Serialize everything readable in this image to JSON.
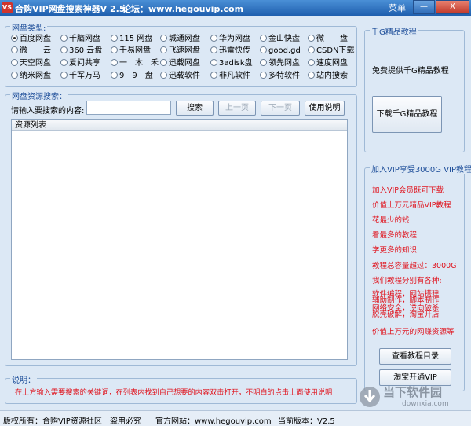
{
  "app": {
    "logo": "VS",
    "title": "合购VIP网盘搜索神器V 2.5",
    "forum": "论坛：www.hegouvip.com",
    "menu": "菜单",
    "min_glyph": "—",
    "close_glyph": "X"
  },
  "disk_type": {
    "legend": "网盘类型:",
    "options": [
      [
        "百度网盘",
        "千脑网盘",
        "115 网盘",
        "城通网盘",
        "华为网盘",
        "金山快盘",
        "微　　盘"
      ],
      [
        "微　　云",
        "360 云盘",
        "千易网盘",
        "飞速网盘",
        "迅雷快传",
        "good.gd",
        "CSDN下载"
      ],
      [
        "天空网盘",
        "爱问共享",
        "一　木　禾",
        "迅载网盘",
        "3adisk盘",
        "领先网盘",
        "速度网盘"
      ],
      [
        "纳米网盘",
        "千军万马",
        "9　9　盘",
        "迅载软件",
        "非凡软件",
        "多特软件",
        "站内搜索"
      ]
    ]
  },
  "search": {
    "legend": "网盘资源搜索：",
    "label": "请输入要搜索的内容:",
    "value": "",
    "search_btn": "搜索",
    "prev_btn": "上一页",
    "next_btn": "下一页",
    "help_btn": "使用说明",
    "list_header": "资源列表"
  },
  "note": {
    "legend": "说明：",
    "text": "在上方输入需要搜索的关键词，在列表内找到自己想要的内容双击打开，不明白的点击上面使用说明"
  },
  "tutorial": {
    "legend": "千G精品教程",
    "free_text": "免费提供千G精品教程",
    "download_btn": "下载千G精品教程"
  },
  "vip": {
    "legend": "加入VIP享受3000G VIP教程",
    "lines": [
      "加入VIP会员既可下载",
      "价值上万元精品VIP教程",
      "花最少的钱",
      "看最多的教程",
      "学更多的知识",
      "教程总容量超过：3000G",
      "我们教程分别有各种:"
    ],
    "overlap_a": "软件编程，网站搭建",
    "overlap_b": "辅助制作，脚本制作",
    "overlap_c": "网络安全，逆向破杀",
    "overlap_d": "脱壳破解，淘宝开店",
    "value_line": "价值上万元的网赚资源等",
    "catalog_btn": "查看教程目录",
    "taobao_btn": "淘宝开通VIP"
  },
  "status": {
    "copyright": "版权所有：合购VIP资源社区　盗用必究",
    "site": "官方网站：www.hegouvip.com",
    "version": "当前版本：V2.5"
  },
  "watermark": {
    "name": "当下软件园",
    "url": "downxia.com"
  }
}
